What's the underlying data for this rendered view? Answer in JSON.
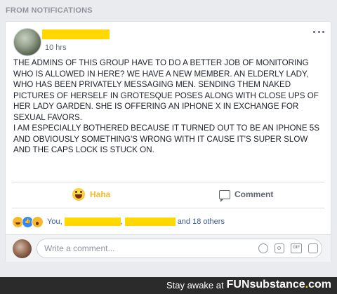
{
  "section_header": "FROM NOTIFICATIONS",
  "post": {
    "time": "10 hrs",
    "text": "THE ADMINS OF THIS GROUP HAVE TO DO A BETTER JOB OF MONITORING WHO IS ALLOWED IN HERE? WE HAVE A NEW MEMBER. AN ELDERLY LADY, WHO HAS BEEN PRIVATELY MESSAGING MEN. SENDING THEM NAKED PICTURES OF HERSELF IN GROTESQUE POSES ALONG WITH CLOSE UPS OF HER LADY GARDEN. SHE IS OFFERING AN IPHONE X IN EXCHANGE FOR SEXUAL FAVORS.\nI AM ESPECIALLY BOTHERED BECAUSE IT TURNED OUT TO BE AN IPHONE 5S AND OBVIOUSLY SOMETHING'S WRONG WITH IT CAUSE IT'S SUPER SLOW AND THE CAPS LOCK IS STUCK ON."
  },
  "actions": {
    "reaction_label": "Haha",
    "comment_label": "Comment"
  },
  "reactions": {
    "icons": [
      "haha-icon",
      "like-icon",
      "wow-icon"
    ],
    "you": "You,",
    "sep": ",",
    "others": "and 18 others"
  },
  "comment_box": {
    "placeholder": "Write a comment..."
  },
  "footer": {
    "prefix": "Stay awake at",
    "logo_fun": "FUN",
    "logo_sub": "substance",
    "logo_dot": ".",
    "logo_com": "com"
  },
  "colors": {
    "haha": "#f7b928",
    "link": "#365899",
    "redaction": "#ffd800"
  }
}
